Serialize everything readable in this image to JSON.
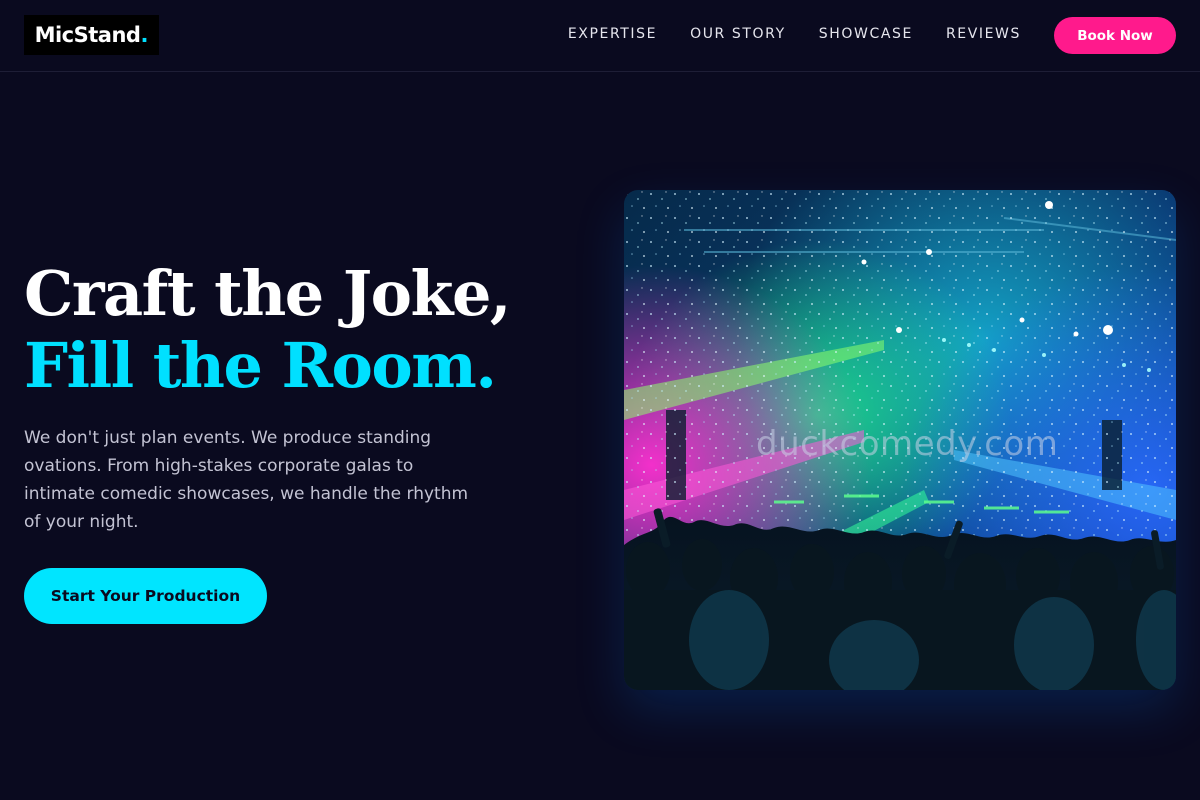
{
  "header": {
    "logo_text": "MicStand",
    "logo_dot": ".",
    "nav": [
      {
        "label": "EXPERTISE"
      },
      {
        "label": "OUR STORY"
      },
      {
        "label": "SHOWCASE"
      },
      {
        "label": "REVIEWS"
      }
    ],
    "book_label": "Book Now"
  },
  "hero": {
    "heading_line_1": "Craft the Joke,",
    "heading_line_2": "Fill the Room.",
    "description": "We don't just plan events. We produce standing ovations. From high-stakes corporate galas to intimate comedic showcases, we handle the rhythm of your night.",
    "cta_label": "Start Your Production",
    "image": {
      "subject": "concert-crowd-image",
      "watermark": "duckcomedy.com"
    }
  },
  "colors": {
    "background": "#0a0a1f",
    "accent_cyan": "#00e0ff",
    "accent_pink": "#ff1a8c",
    "body_text": "#c3c3d3"
  }
}
